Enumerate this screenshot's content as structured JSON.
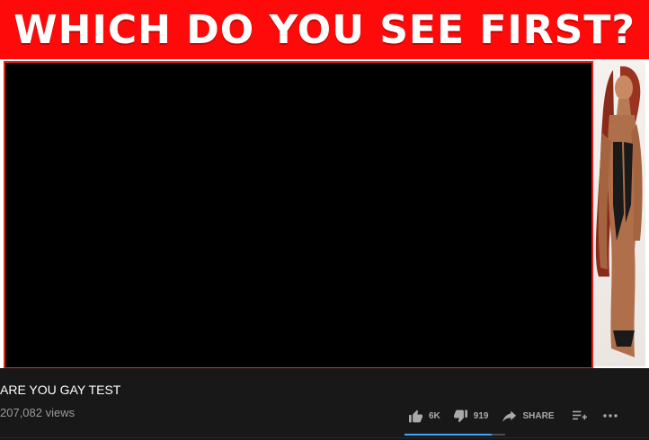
{
  "thumbnail": {
    "banner_text": "WHICH DO YOU SEE FIRST?",
    "banner_color": "#ff0a0a",
    "video_frame_border_color": "#e0201e"
  },
  "video": {
    "title": "ARE YOU GAY TEST",
    "views": "207,082 views"
  },
  "actions": {
    "like_count": "6K",
    "dislike_count": "919",
    "share_label": "SHARE",
    "like_icon": "thumbs-up-icon",
    "dislike_icon": "thumbs-down-icon",
    "share_icon": "share-arrow-icon",
    "save_icon": "add-to-playlist-icon",
    "more_icon": "more-options-icon"
  },
  "sentiment": {
    "like_fraction": 0.87,
    "like_color": "#3ea6ff"
  },
  "theme": {
    "background": "#181818",
    "text_primary": "#ffffff",
    "text_secondary": "#aaaaaa"
  }
}
